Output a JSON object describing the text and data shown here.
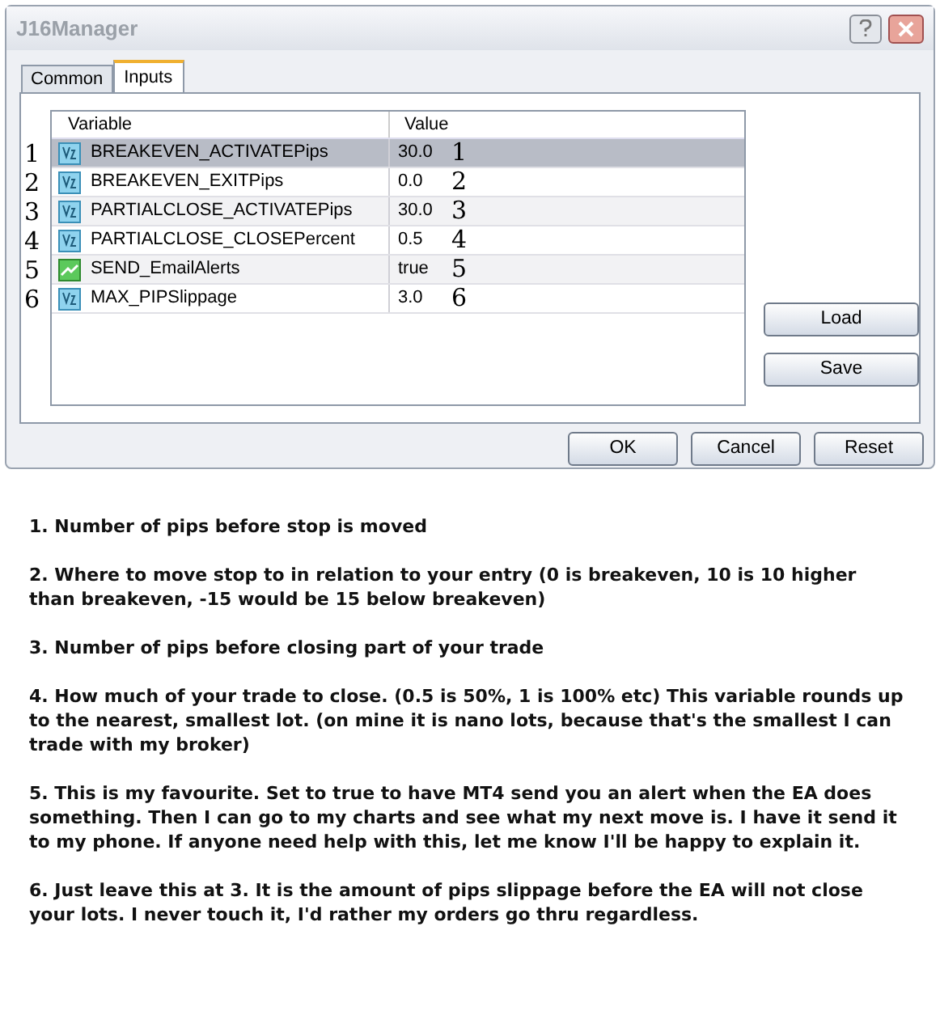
{
  "window": {
    "title": "J16Manager"
  },
  "tabs": [
    {
      "label": "Common",
      "selected": false
    },
    {
      "label": "Inputs",
      "selected": true
    }
  ],
  "table": {
    "columns": [
      "Variable",
      "Value"
    ],
    "rows": [
      {
        "marker": "1",
        "kind": "number",
        "variable": "BREAKEVEN_ACTIVATEPips",
        "value": "30.0",
        "note": "1",
        "selected": true
      },
      {
        "marker": "2",
        "kind": "number",
        "variable": "BREAKEVEN_EXITPips",
        "value": "0.0",
        "note": "2",
        "selected": false
      },
      {
        "marker": "3",
        "kind": "number",
        "variable": "PARTIALCLOSE_ACTIVATEPips",
        "value": "30.0",
        "note": "3",
        "selected": false
      },
      {
        "marker": "4",
        "kind": "number",
        "variable": "PARTIALCLOSE_CLOSEPercent",
        "value": "0.5",
        "note": "4",
        "selected": false
      },
      {
        "marker": "5",
        "kind": "bool",
        "variable": "SEND_EmailAlerts",
        "value": "true",
        "note": "5",
        "selected": false
      },
      {
        "marker": "6",
        "kind": "number",
        "variable": "MAX_PIPSlippage",
        "value": "3.0",
        "note": "6",
        "selected": false
      }
    ]
  },
  "side_buttons": [
    "Load",
    "Save"
  ],
  "buttons": [
    "OK",
    "Cancel",
    "Reset"
  ],
  "notes": [
    "1. Number of pips before stop is moved",
    "2. Where to move stop to in relation to your entry (0 is breakeven, 10 is 10 higher than breakeven, -15 would be 15 below breakeven)",
    "3. Number of pips before closing part of your trade",
    "4. How much of your trade to close. (0.5 is 50%, 1 is 100% etc) This variable rounds up to the nearest, smallest lot. (on mine it is nano lots, because that's the smallest I can trade with my broker)",
    "5. This is my favourite. Set to true to have MT4 send you an alert when the EA does something. Then I can go to my charts and see what my next move is. I have it send it to my phone. If anyone need help with this, let me know I'll be happy to explain it.",
    "6. Just leave this at 3. It is the amount of pips slippage before the EA will not close your lots. I never touch it, I'd rather my orders go thru regardless."
  ]
}
